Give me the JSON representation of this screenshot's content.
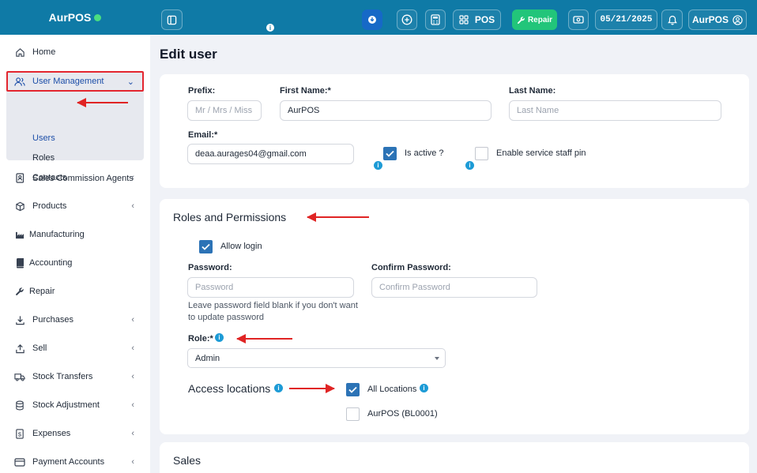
{
  "brand": {
    "name": "AurPOS"
  },
  "topbar": {
    "pos_label": "POS",
    "repair_label": "Repair",
    "date": "05/21/2025",
    "user_label": "AurPOS",
    "info_badge": "i"
  },
  "sidebar": {
    "items": [
      {
        "label": "Home",
        "icon": "home-icon"
      },
      {
        "label": "User Management",
        "icon": "users-icon"
      },
      {
        "label": "Contacts",
        "icon": "contacts-icon"
      },
      {
        "label": "Products",
        "icon": "cube-icon"
      },
      {
        "label": "Manufacturing",
        "icon": "factory-icon"
      },
      {
        "label": "Accounting",
        "icon": "book-icon"
      },
      {
        "label": "Repair",
        "icon": "wrench-icon"
      },
      {
        "label": "Purchases",
        "icon": "download-icon"
      },
      {
        "label": "Sell",
        "icon": "upload-icon"
      },
      {
        "label": "Stock Transfers",
        "icon": "truck-icon"
      },
      {
        "label": "Stock Adjustment",
        "icon": "database-icon"
      },
      {
        "label": "Expenses",
        "icon": "receipt-icon"
      },
      {
        "label": "Payment Accounts",
        "icon": "card-icon"
      }
    ],
    "submenu": [
      "Users",
      "Roles",
      "Sales Commission Agents"
    ]
  },
  "page": {
    "title": "Edit user"
  },
  "user_form": {
    "prefix_label": "Prefix:",
    "prefix_placeholder": "Mr / Mrs / Miss",
    "first_name_label": "First Name:*",
    "first_name_value": "AurPOS",
    "last_name_label": "Last Name:",
    "last_name_placeholder": "Last Name",
    "email_label": "Email:*",
    "email_value": "deaa.aurages04@gmail.com",
    "is_active_label": "Is active ?",
    "is_active_checked": true,
    "service_pin_label": "Enable service staff pin",
    "service_pin_checked": false
  },
  "roles": {
    "title": "Roles and Permissions",
    "allow_login_label": "Allow login",
    "allow_login_checked": true,
    "password_label": "Password:",
    "password_placeholder": "Password",
    "confirm_label": "Confirm Password:",
    "confirm_placeholder": "Confirm Password",
    "password_hint": "Leave password field blank if you don't want to update password",
    "role_label": "Role:*",
    "role_value": "Admin",
    "access_title": "Access locations",
    "all_locations_label": "All Locations",
    "all_locations_checked": true,
    "location_label": "AurPOS (BL0001)",
    "location_checked": false
  },
  "sales": {
    "title": "Sales"
  },
  "colors": {
    "header": "#0f7aa6",
    "accent": "#1c4ea8",
    "checkbox": "#2c73b6",
    "repair": "#22c57a",
    "annotation": "#e02424"
  }
}
